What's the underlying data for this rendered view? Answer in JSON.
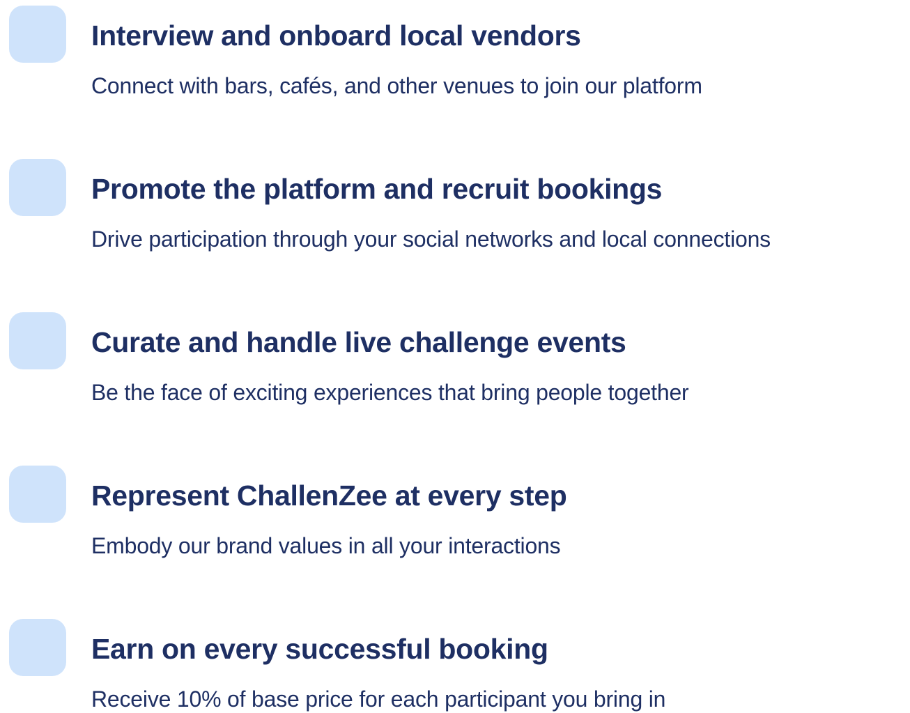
{
  "accent": "#cfe3fb",
  "text_color": "#1e2f63",
  "items": [
    {
      "title": "Interview and onboard local vendors",
      "description": "Connect with bars, cafés, and other venues to join our platform"
    },
    {
      "title": "Promote the platform and recruit bookings",
      "description": "Drive participation through your social networks and local connections"
    },
    {
      "title": "Curate and handle live challenge events",
      "description": "Be the face of exciting experiences that bring people together"
    },
    {
      "title": "Represent ChallenZee at every step",
      "description": "Embody our brand values in all your interactions"
    },
    {
      "title": "Earn on every successful booking",
      "description": "Receive 10% of base price for each participant you bring in"
    }
  ]
}
